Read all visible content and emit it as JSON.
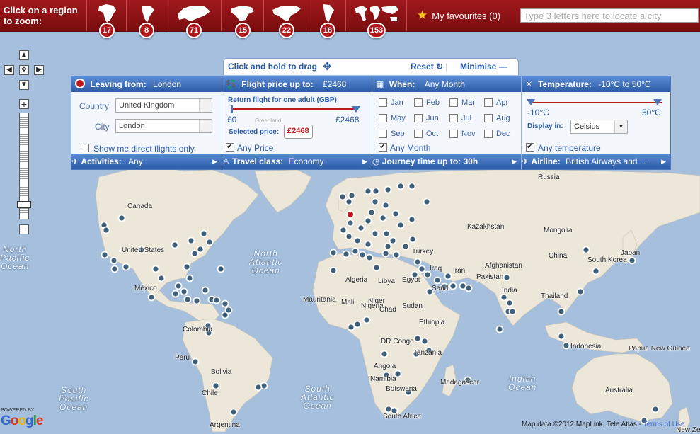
{
  "topbar": {
    "zoom_hint_line1": "Click on a region",
    "zoom_hint_line2": "to zoom:",
    "regions": [
      {
        "name": "africa",
        "count": "17"
      },
      {
        "name": "south-america",
        "count": "8"
      },
      {
        "name": "europe",
        "count": "71"
      },
      {
        "name": "north-america",
        "count": "15"
      },
      {
        "name": "north-america-wide",
        "count": "22"
      },
      {
        "name": "latin-america",
        "count": "18"
      },
      {
        "name": "world",
        "count": "153"
      }
    ],
    "favourites_label": "My favourites (0)",
    "city_search_placeholder": "Type 3 letters here to locate a city"
  },
  "panel": {
    "drag_label": "Click and hold to drag",
    "reset_label": "Reset",
    "minimise_label": "Minimise",
    "leaving": {
      "title": "Leaving from:",
      "value": "London",
      "country_label": "Country",
      "country_value": "United Kingdom",
      "city_label": "City",
      "city_value": "London",
      "direct_label": "Show me direct flights only"
    },
    "price": {
      "title": "Flight price up to:",
      "value": "£2468",
      "subtitle": "Return flight for one adult (GBP)",
      "min_label": "£0",
      "max_label": "£2468",
      "selected_label": "Selected price:",
      "selected_value": "£2468",
      "any_label": "Any Price",
      "map_hint": "Greenland"
    },
    "when": {
      "title": "When:",
      "value": "Any Month",
      "months": [
        "Jan",
        "Feb",
        "Mar",
        "Apr",
        "May",
        "Jun",
        "Jul",
        "Aug",
        "Sep",
        "Oct",
        "Nov",
        "Dec"
      ],
      "any_label": "Any Month"
    },
    "temperature": {
      "title": "Temperature:",
      "value": "-10°C to 50°C",
      "min_label": "-10°C",
      "max_label": "50°C",
      "display_label": "Display in:",
      "unit": "Celsius",
      "any_label": "Any temperature"
    },
    "footer": {
      "activities_label": "Activities:",
      "activities_value": "Any",
      "class_label": "Travel class:",
      "class_value": "Economy",
      "journey_label": "Journey time up to: 30h",
      "airline_label": "Airline:",
      "airline_value": "British Airways and ..."
    }
  },
  "map": {
    "country_labels": [
      {
        "id": "canada",
        "text": "Canada"
      },
      {
        "id": "usa",
        "text": "United States"
      },
      {
        "id": "mexico",
        "text": "México"
      },
      {
        "id": "colombia",
        "text": "Colombia"
      },
      {
        "id": "peru",
        "text": "Peru"
      },
      {
        "id": "bolivia",
        "text": "Bolivia"
      },
      {
        "id": "chile",
        "text": "Chile"
      },
      {
        "id": "argentina",
        "text": "Argentina"
      },
      {
        "id": "russia",
        "text": "Russia"
      },
      {
        "id": "kazakhstan",
        "text": "Kazakhstan"
      },
      {
        "id": "mongolia",
        "text": "Mongolia"
      },
      {
        "id": "china",
        "text": "China"
      },
      {
        "id": "japan",
        "text": "Japan"
      },
      {
        "id": "south-korea",
        "text": "South Korea"
      },
      {
        "id": "turkey",
        "text": "Turkey"
      },
      {
        "id": "iraq",
        "text": "Iraq"
      },
      {
        "id": "iran",
        "text": "Iran"
      },
      {
        "id": "afghanistan",
        "text": "Afghanistan"
      },
      {
        "id": "pakistan",
        "text": "Pakistan"
      },
      {
        "id": "india",
        "text": "India"
      },
      {
        "id": "saudi",
        "text": "Saudi"
      },
      {
        "id": "thailand",
        "text": "Thailand"
      },
      {
        "id": "indonesia",
        "text": "Indonesia"
      },
      {
        "id": "papua",
        "text": "Papua New Guinea"
      },
      {
        "id": "australia",
        "text": "Australia"
      },
      {
        "id": "new-zealand",
        "text": "New Zealand"
      },
      {
        "id": "algeria",
        "text": "Algeria"
      },
      {
        "id": "libya",
        "text": "Libya"
      },
      {
        "id": "egypt",
        "text": "Egypt"
      },
      {
        "id": "mauritania",
        "text": "Mauritania"
      },
      {
        "id": "mali",
        "text": "Mali"
      },
      {
        "id": "niger",
        "text": "Niger"
      },
      {
        "id": "nigeria",
        "text": "Nigeria"
      },
      {
        "id": "chad",
        "text": "Chad"
      },
      {
        "id": "sudan",
        "text": "Sudan"
      },
      {
        "id": "ethiopia",
        "text": "Ethiopia"
      },
      {
        "id": "drc",
        "text": "DR Congo"
      },
      {
        "id": "tanzania",
        "text": "Tanzania"
      },
      {
        "id": "angola",
        "text": "Angola"
      },
      {
        "id": "namibia",
        "text": "Namibia"
      },
      {
        "id": "botswana",
        "text": "Botswana"
      },
      {
        "id": "madagascar",
        "text": "Madagascar"
      },
      {
        "id": "south-africa",
        "text": "South Africa"
      }
    ],
    "oceans": [
      {
        "id": "north-pacific",
        "line1": "North",
        "line2": "Pacific",
        "line3": "Ocean"
      },
      {
        "id": "north-atlantic",
        "line1": "North",
        "line2": "Atlantic",
        "line3": "Ocean"
      },
      {
        "id": "south-pacific",
        "line1": "South",
        "line2": "Pacific",
        "line3": "Ocean"
      },
      {
        "id": "south-atlantic",
        "line1": "South",
        "line2": "Atlantic",
        "line3": "Ocean"
      },
      {
        "id": "indian",
        "line1": "Indian",
        "line2": "Ocean",
        "line3": ""
      }
    ],
    "credits": "Map data ©2012  MapLink, Tele Atlas - ",
    "credits_link": "Terms of Use",
    "powered_by": "POWERED BY",
    "google": [
      "G",
      "o",
      "o",
      "g",
      "l",
      "e"
    ],
    "colors": {
      "ocean": "#a5bfdd",
      "land": "#e8e3d5",
      "accent": "#a0191c",
      "panel_blue": "#2c5ba6",
      "marker": "#3e5f7a"
    }
  }
}
